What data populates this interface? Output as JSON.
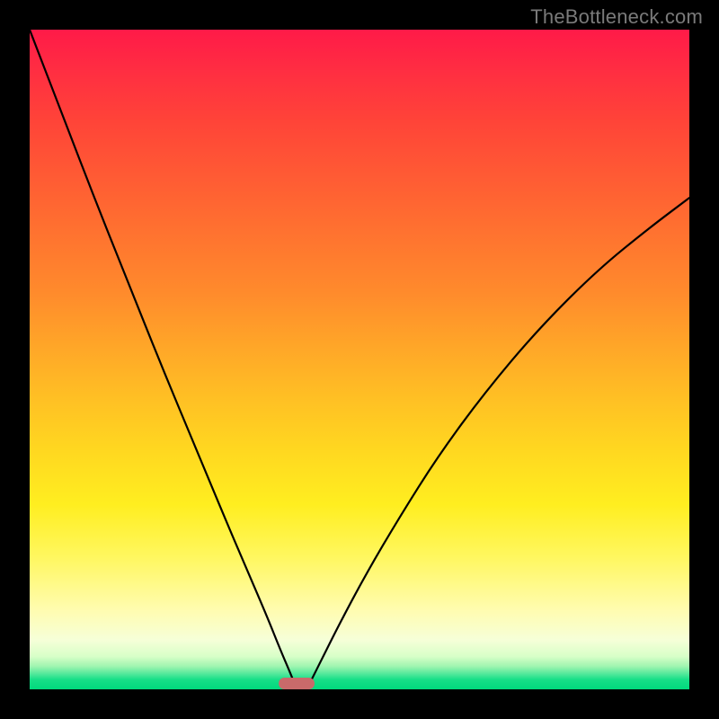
{
  "watermark": {
    "text": "TheBottleneck.com"
  },
  "chart_data": {
    "type": "line",
    "title": "",
    "xlabel": "",
    "ylabel": "",
    "xlim": [
      0,
      1
    ],
    "ylim": [
      0,
      1
    ],
    "grid": false,
    "legend": false,
    "background_gradient": {
      "orientation": "vertical",
      "stops": [
        {
          "pos": 0.0,
          "color": "#ff1a48"
        },
        {
          "pos": 0.3,
          "color": "#ff7030"
        },
        {
          "pos": 0.55,
          "color": "#ffc024"
        },
        {
          "pos": 0.8,
          "color": "#fff760"
        },
        {
          "pos": 0.93,
          "color": "#f6ffd8"
        },
        {
          "pos": 1.0,
          "color": "#00d97c"
        }
      ]
    },
    "marker": {
      "x": 0.405,
      "y": 0.0,
      "width_frac": 0.055,
      "color": "#c96a6a",
      "shape": "rounded-bar"
    },
    "series": [
      {
        "name": "left-curve",
        "x": [
          0.0,
          0.05,
          0.1,
          0.15,
          0.2,
          0.25,
          0.3,
          0.33,
          0.36,
          0.38,
          0.395,
          0.405
        ],
        "values": [
          1.0,
          0.87,
          0.74,
          0.615,
          0.49,
          0.37,
          0.25,
          0.18,
          0.11,
          0.06,
          0.025,
          0.0
        ]
      },
      {
        "name": "right-curve",
        "x": [
          0.42,
          0.44,
          0.47,
          0.51,
          0.56,
          0.62,
          0.69,
          0.77,
          0.86,
          0.94,
          1.0
        ],
        "values": [
          0.0,
          0.04,
          0.1,
          0.175,
          0.26,
          0.355,
          0.45,
          0.545,
          0.635,
          0.7,
          0.745
        ]
      }
    ]
  }
}
